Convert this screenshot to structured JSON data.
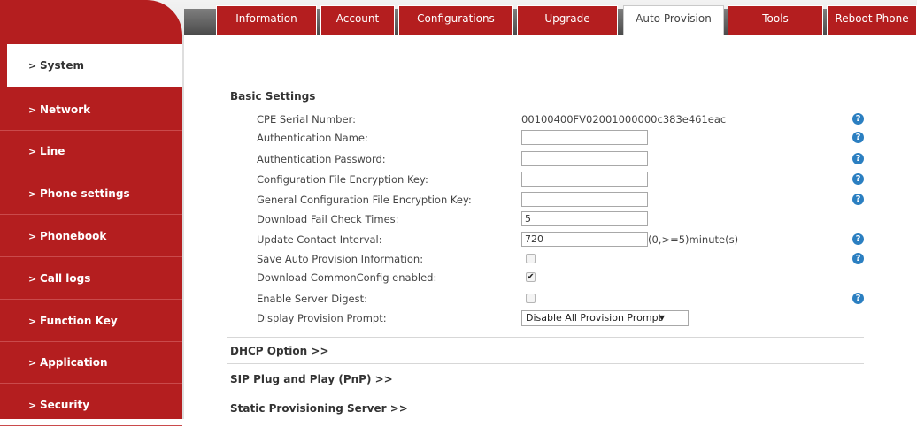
{
  "tabs": [
    {
      "label": "Information",
      "active": false
    },
    {
      "label": "Account",
      "active": false
    },
    {
      "label": "Configurations",
      "active": false
    },
    {
      "label": "Upgrade",
      "active": false
    },
    {
      "label": "Auto Provision",
      "active": true
    },
    {
      "label": "Tools",
      "active": false
    },
    {
      "label": "Reboot Phone",
      "active": false
    }
  ],
  "sidebar": {
    "chevron": ">",
    "items": [
      {
        "label": "System",
        "active": true
      },
      {
        "label": "Network",
        "active": false
      },
      {
        "label": "Line",
        "active": false
      },
      {
        "label": "Phone settings",
        "active": false
      },
      {
        "label": "Phonebook",
        "active": false
      },
      {
        "label": "Call logs",
        "active": false
      },
      {
        "label": "Function Key",
        "active": false
      },
      {
        "label": "Application",
        "active": false
      },
      {
        "label": "Security",
        "active": false
      }
    ]
  },
  "basic_settings": {
    "title": "Basic Settings",
    "cpe_serial": {
      "label": "CPE Serial Number:",
      "value": "00100400FV02001000000c383e461eac"
    },
    "auth_name": {
      "label": "Authentication Name:",
      "value": ""
    },
    "auth_password": {
      "label": "Authentication Password:",
      "value": ""
    },
    "config_key": {
      "label": "Configuration File Encryption Key:",
      "value": ""
    },
    "general_key": {
      "label": "General Configuration File Encryption Key:",
      "value": ""
    },
    "fail_check": {
      "label": "Download Fail Check Times:",
      "value": "5"
    },
    "update_interval": {
      "label": "Update Contact Interval:",
      "value": "720",
      "suffix": "(0,>=5)minute(s)"
    },
    "save_info": {
      "label": "Save Auto Provision Information:",
      "checked": false
    },
    "common_config": {
      "label": "Download CommonConfig enabled:",
      "checked": true,
      "mark": "✔"
    },
    "server_digest": {
      "label": "Enable Server Digest:",
      "checked": false
    },
    "provision_prompt": {
      "label": "Display Provision Prompt:",
      "selected": "Disable All Provision Prompt",
      "arrow": "▼"
    }
  },
  "help_glyph": "?",
  "sections": {
    "dhcp": "DHCP Option >>",
    "pnp": "SIP Plug and Play (PnP) >>",
    "static": "Static Provisioning Server >>"
  },
  "colors": {
    "brand_red": "#b41e1f",
    "help_blue": "#2b7fc1"
  }
}
